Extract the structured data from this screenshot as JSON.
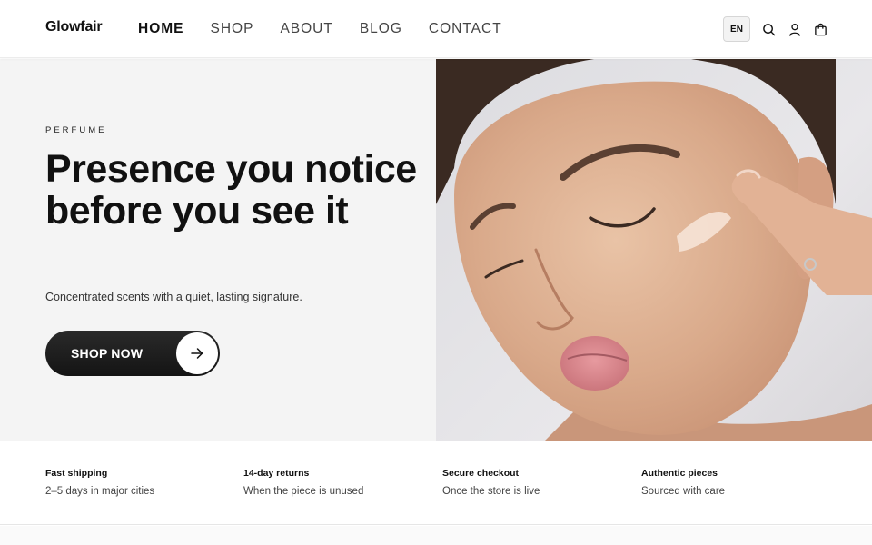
{
  "brand": {
    "name": "Glowfair"
  },
  "nav": {
    "items": [
      {
        "label": "HOME",
        "active": true
      },
      {
        "label": "SHOP",
        "active": false
      },
      {
        "label": "ABOUT",
        "active": false
      },
      {
        "label": "BLOG",
        "active": false
      },
      {
        "label": "CONTACT",
        "active": false
      }
    ]
  },
  "header_actions": {
    "language": "EN",
    "icons": [
      "search-icon",
      "user-icon",
      "bag-icon"
    ]
  },
  "hero": {
    "eyebrow": "PERFUME",
    "headline": "Presence you notice before you see it",
    "subline": "Concentrated scents with a quiet, lasting signature.",
    "cta_label": "SHOP NOW",
    "cta_icon": "arrow-right-icon"
  },
  "features": [
    {
      "title": "Fast shipping",
      "text": "2–5 days in major cities"
    },
    {
      "title": "14-day returns",
      "text": "When the piece is unused"
    },
    {
      "title": "Secure checkout",
      "text": "Once the store is live"
    },
    {
      "title": "Authentic pieces",
      "text": "Sourced with care"
    }
  ],
  "colors": {
    "accent": "#111111",
    "hero_bg": "#f4f4f4",
    "cta_bg": "#1a1a1a"
  }
}
